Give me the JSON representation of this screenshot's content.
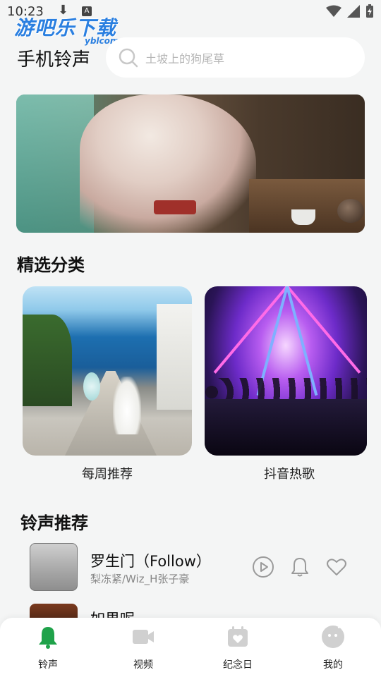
{
  "status_bar": {
    "time": "10:23",
    "download_glyph": "⬇",
    "a_badge": "A"
  },
  "watermark": {
    "text": "游吧乐下载",
    "sub": "yblcom"
  },
  "header": {
    "title": "手机铃声",
    "search_placeholder": "土坡上的狗尾草"
  },
  "sections": {
    "categories_title": "精选分类",
    "ringtones_title": "铃声推荐"
  },
  "categories": [
    {
      "label": "每周推荐"
    },
    {
      "label": "抖音热歌"
    }
  ],
  "ringtones": [
    {
      "title": "罗生门（Follow）",
      "artist": "梨冻紧/Wiz_H张子豪"
    },
    {
      "title": "如果呢",
      "artist": ""
    }
  ],
  "bottom_nav": [
    {
      "label": "铃声",
      "icon": "bell-icon",
      "active": true
    },
    {
      "label": "视频",
      "icon": "video-icon",
      "active": false
    },
    {
      "label": "纪念日",
      "icon": "calendar-heart-icon",
      "active": false
    },
    {
      "label": "我的",
      "icon": "profile-icon",
      "active": false
    }
  ],
  "colors": {
    "accent": "#1fa24a",
    "inactive_icon": "#d0d0d0",
    "background": "#f4f5f5"
  }
}
